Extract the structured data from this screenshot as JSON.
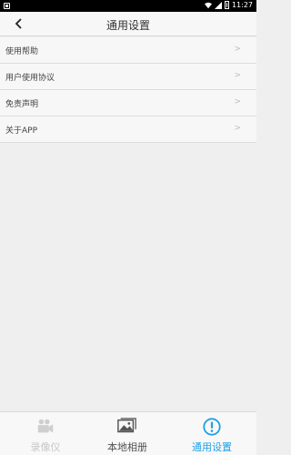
{
  "status_bar": {
    "time": "11:27"
  },
  "header": {
    "title": "通用设置",
    "back_icon": "chevron-left-icon"
  },
  "menu": {
    "items": [
      {
        "label": "使用帮助",
        "icon": "chevron-right-icon"
      },
      {
        "label": "用户使用协议",
        "icon": "chevron-right-icon"
      },
      {
        "label": "免责声明",
        "icon": "chevron-right-icon"
      },
      {
        "label": "关于APP",
        "icon": "chevron-right-icon"
      }
    ],
    "arrow_glyph": ">"
  },
  "tabbar": {
    "tabs": [
      {
        "label": "录像仪",
        "icon": "video-camera-icon",
        "color": "#c8c8c8"
      },
      {
        "label": "本地相册",
        "icon": "gallery-icon",
        "color": "#505050"
      },
      {
        "label": "通用设置",
        "icon": "info-circle-icon",
        "color": "#1ea0e6",
        "active": true
      }
    ]
  }
}
